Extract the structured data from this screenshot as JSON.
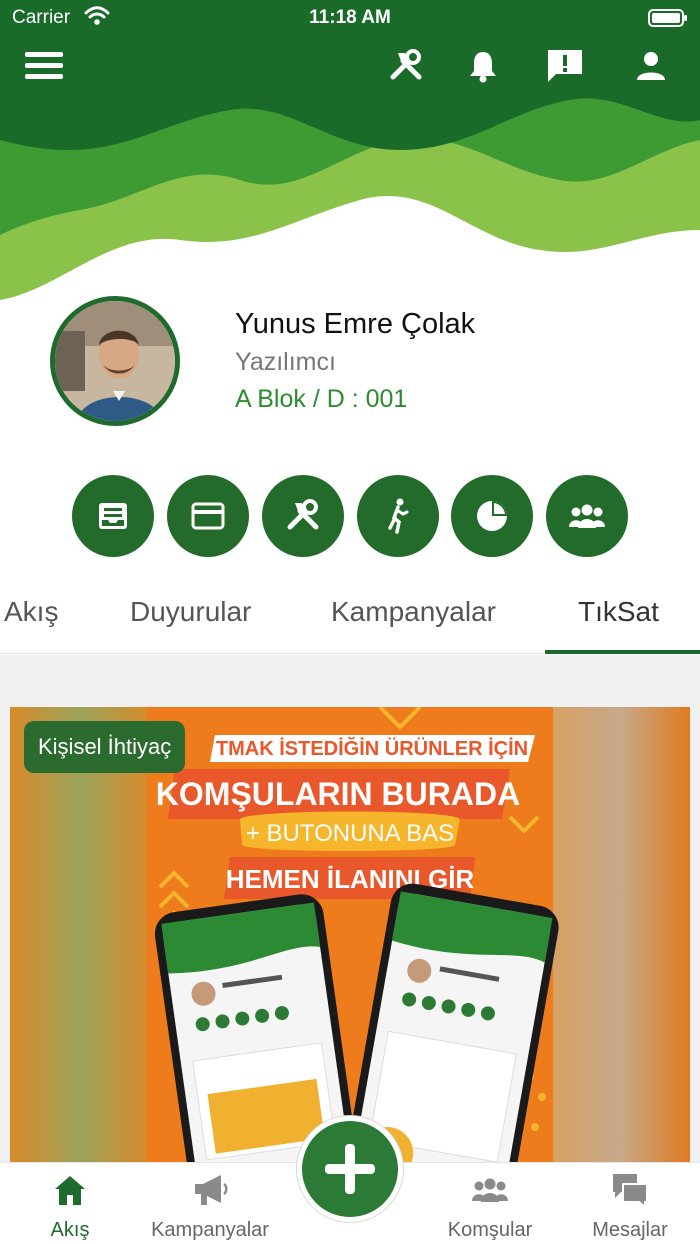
{
  "status_bar": {
    "carrier": "Carrier",
    "time": "11:18 AM"
  },
  "header": {
    "icons": [
      "menu-icon",
      "tools-icon",
      "bell-icon",
      "feedback-icon",
      "user-icon"
    ],
    "colors": {
      "dark_green": "#1a6a2a",
      "mid_green": "#3a9a35",
      "light_green": "#8bc34a"
    }
  },
  "profile": {
    "name": "Yunus Emre Çolak",
    "role": "Yazılımcı",
    "unit": "A Blok / D : 001"
  },
  "quick_actions": [
    "inbox-icon",
    "card-icon",
    "tools-icon",
    "walk-icon",
    "pie-chart-icon",
    "group-icon"
  ],
  "tabs": {
    "items": [
      "Akış",
      "Duyurular",
      "Kampanyalar",
      "TıkSat"
    ],
    "active": "TıkSat"
  },
  "feed": {
    "card": {
      "badge": "Kişisel İhtiyaç",
      "headline_1": "TMAK İSTEDİĞİN ÜRÜNLER İÇİN",
      "headline_2": "KOMŞULARIN BURADA",
      "headline_3": "+ BUTONUNA BAS",
      "headline_4": "HEMEN İLANINI GİR"
    }
  },
  "bottom_nav": {
    "items": [
      {
        "label": "Akış",
        "icon": "home-icon",
        "active": true
      },
      {
        "label": "Kampanyalar",
        "icon": "megaphone-icon",
        "active": false
      },
      {
        "label": "Komşular",
        "icon": "neighbors-icon",
        "active": false
      },
      {
        "label": "Mesajlar",
        "icon": "messages-icon",
        "active": false
      }
    ],
    "fab_icon": "plus-icon"
  }
}
